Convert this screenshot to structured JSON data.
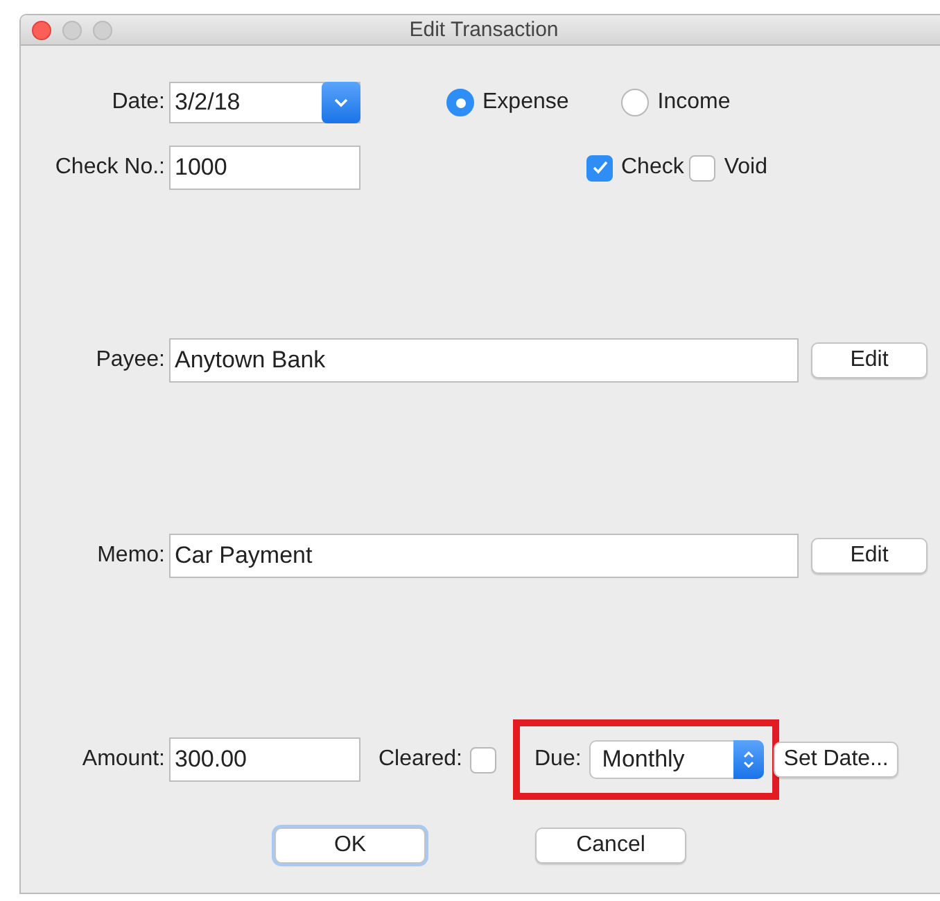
{
  "window": {
    "title": "Edit Transaction"
  },
  "date": {
    "label": "Date:",
    "value": "3/2/18"
  },
  "type_options": [
    {
      "label": "Expense",
      "selected": true
    },
    {
      "label": "Income",
      "selected": false
    }
  ],
  "check_no": {
    "label": "Check No.:",
    "value": "1000"
  },
  "flags": [
    {
      "label": "Check",
      "checked": true
    },
    {
      "label": "Void",
      "checked": false
    }
  ],
  "payee": {
    "label": "Payee:",
    "value": "Anytown Bank",
    "button": "Edit"
  },
  "memo": {
    "label": "Memo:",
    "value": "Car Payment",
    "button": "Edit"
  },
  "amount": {
    "label": "Amount:",
    "value": "300.00"
  },
  "cleared": {
    "label": "Cleared:",
    "checked": false
  },
  "due": {
    "label": "Due:",
    "value": "Monthly",
    "highlighted": true
  },
  "set_date_button": "Set Date...",
  "buttons": [
    {
      "label": "OK",
      "default": true
    },
    {
      "label": "Cancel",
      "default": false
    }
  ]
}
